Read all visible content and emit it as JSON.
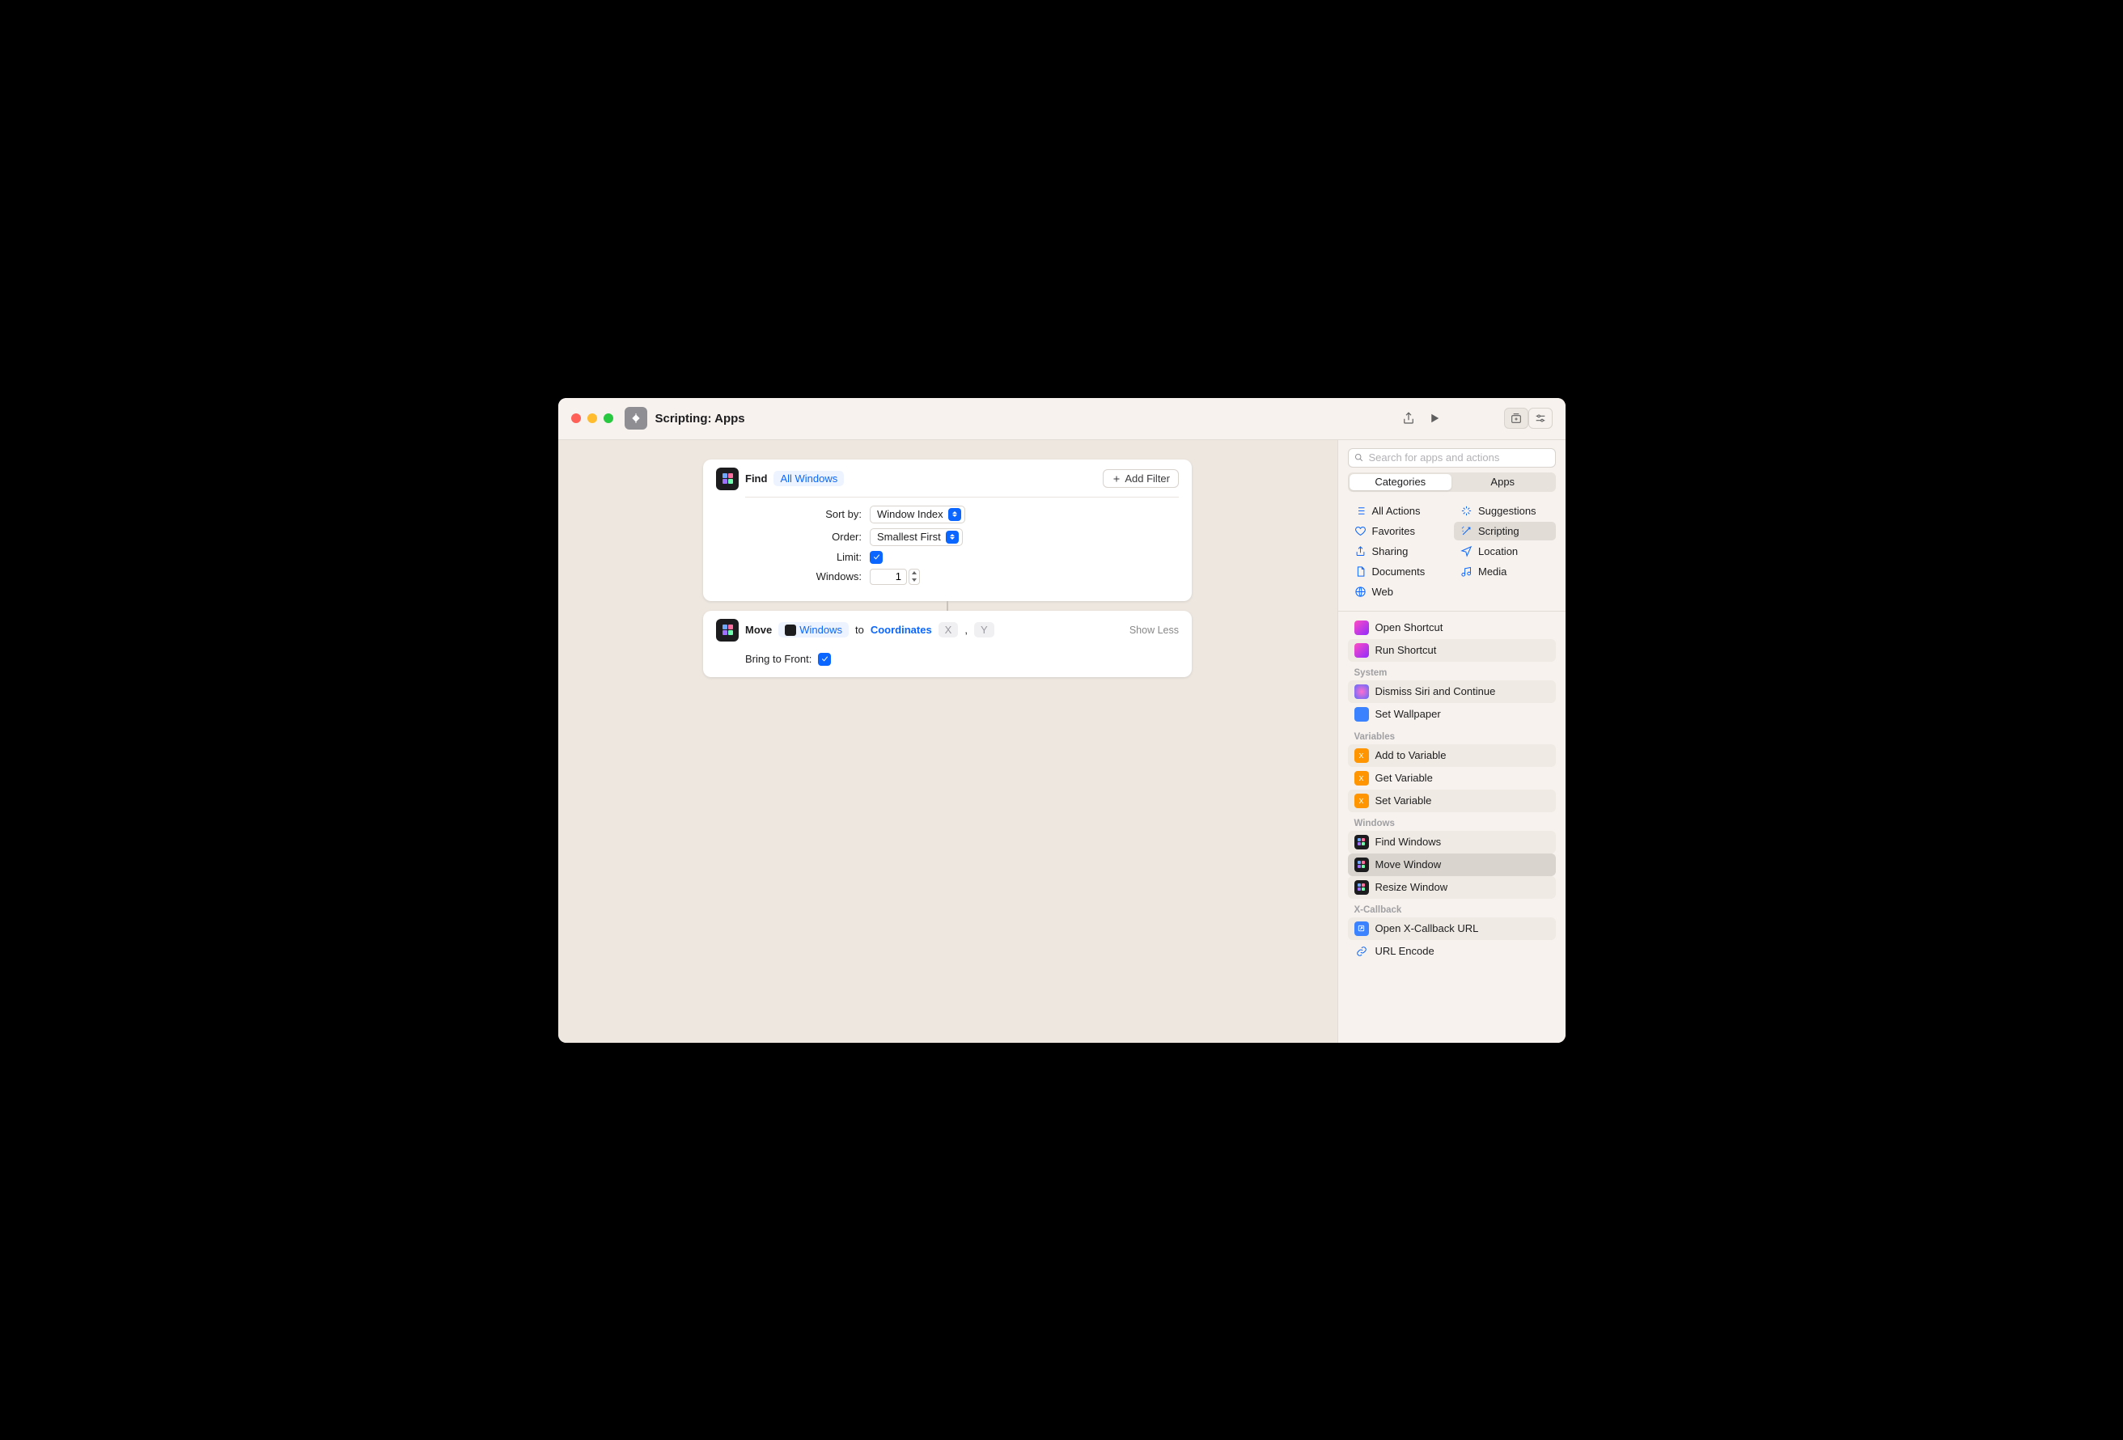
{
  "titlebar": {
    "title": "Scripting: Apps"
  },
  "actions": {
    "find": {
      "verb": "Find",
      "target": "All Windows",
      "add_filter": "Add Filter",
      "sort_by_label": "Sort by:",
      "sort_by_value": "Window Index",
      "order_label": "Order:",
      "order_value": "Smallest First",
      "limit_label": "Limit:",
      "limit_checked": true,
      "windows_label": "Windows:",
      "windows_value": "1"
    },
    "move": {
      "verb": "Move",
      "windows_token": "Windows",
      "to": "to",
      "coordinates": "Coordinates",
      "x": "X",
      "comma": ",",
      "y": "Y",
      "show_less": "Show Less",
      "bring_front_label": "Bring to Front:",
      "bring_front_checked": true
    }
  },
  "sidebar": {
    "search_placeholder": "Search for apps and actions",
    "tabs": {
      "categories": "Categories",
      "apps": "Apps"
    },
    "categories": {
      "all": "All Actions",
      "suggestions": "Suggestions",
      "favorites": "Favorites",
      "scripting": "Scripting",
      "sharing": "Sharing",
      "location": "Location",
      "documents": "Documents",
      "media": "Media",
      "web": "Web"
    },
    "groups": [
      {
        "header": "",
        "items": [
          {
            "label": "Open Shortcut",
            "icon": "shortcut",
            "stripe": false
          },
          {
            "label": "Run Shortcut",
            "icon": "shortcut",
            "stripe": true
          }
        ]
      },
      {
        "header": "System",
        "items": [
          {
            "label": "Dismiss Siri and Continue",
            "icon": "siri",
            "stripe": true
          },
          {
            "label": "Set Wallpaper",
            "icon": "blue",
            "stripe": false
          }
        ]
      },
      {
        "header": "Variables",
        "items": [
          {
            "label": "Add to Variable",
            "icon": "orange",
            "stripe": true
          },
          {
            "label": "Get Variable",
            "icon": "orange",
            "stripe": false
          },
          {
            "label": "Set Variable",
            "icon": "orange",
            "stripe": true
          }
        ]
      },
      {
        "header": "Windows",
        "items": [
          {
            "label": "Find Windows",
            "icon": "dark",
            "stripe": true
          },
          {
            "label": "Move Window",
            "icon": "dark",
            "stripe": false,
            "selected": true
          },
          {
            "label": "Resize Window",
            "icon": "dark",
            "stripe": true
          }
        ]
      },
      {
        "header": "X-Callback",
        "items": [
          {
            "label": "Open X-Callback URL",
            "icon": "bluebox",
            "stripe": true
          },
          {
            "label": "URL Encode",
            "icon": "link",
            "stripe": false
          }
        ]
      }
    ]
  }
}
